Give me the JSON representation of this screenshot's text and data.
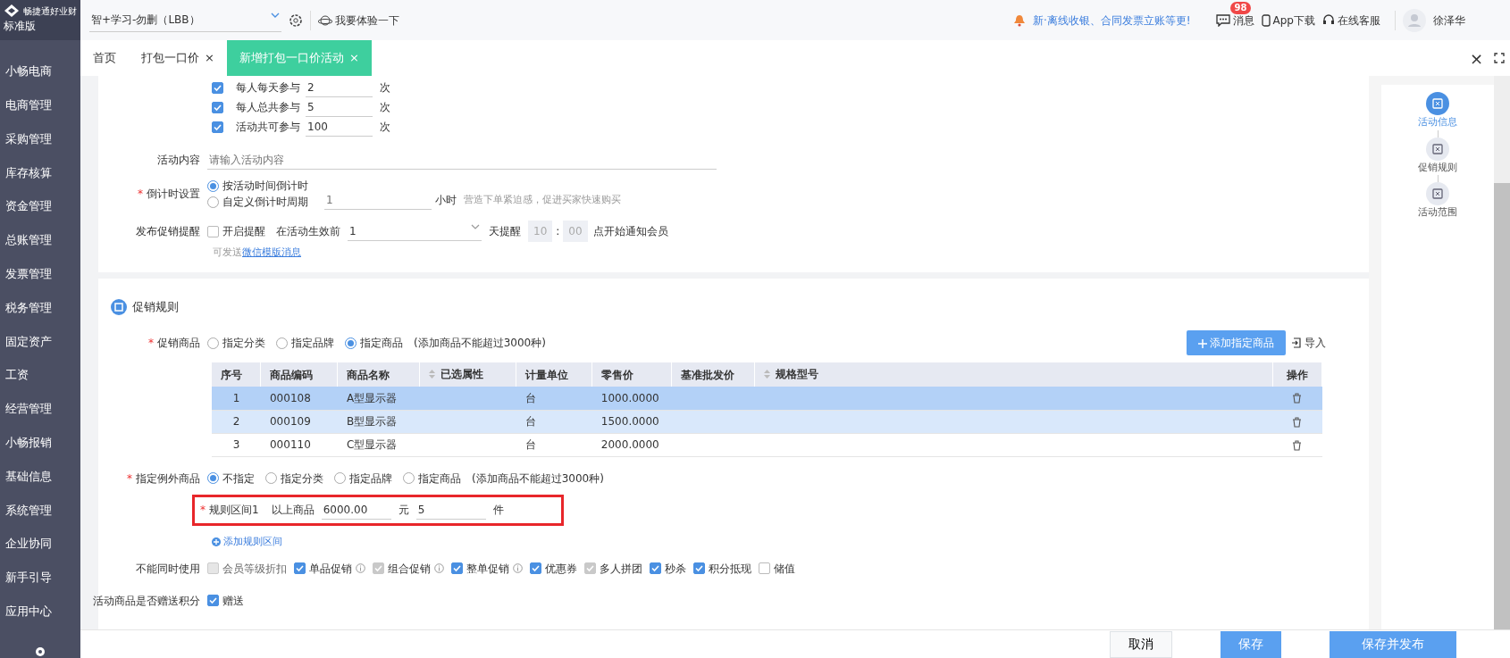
{
  "logo": {
    "brand": "畅捷通好业财",
    "edition": "标准版"
  },
  "sidebar": {
    "items": [
      {
        "label": "小畅电商"
      },
      {
        "label": "电商管理"
      },
      {
        "label": "采购管理"
      },
      {
        "label": "库存核算"
      },
      {
        "label": "资金管理"
      },
      {
        "label": "总账管理"
      },
      {
        "label": "发票管理"
      },
      {
        "label": "税务管理"
      },
      {
        "label": "固定资产"
      },
      {
        "label": "工资"
      },
      {
        "label": "经营管理"
      },
      {
        "label": "小畅报销"
      },
      {
        "label": "基础信息"
      },
      {
        "label": "系统管理"
      },
      {
        "label": "企业协同"
      },
      {
        "label": "新手引导"
      },
      {
        "label": "应用中心"
      }
    ]
  },
  "header": {
    "org": "智+学习-勿删（LBB）",
    "try_label": "我要体验一下",
    "notice": "新·离线收银、合同发票立账等更!",
    "messages": "消息",
    "message_count": "98",
    "app": "App下载",
    "service": "在线客服",
    "user": "徐泽华"
  },
  "tabs": [
    {
      "label": "首页",
      "selected": false
    },
    {
      "label": "打包一口价",
      "close": "×",
      "selected": false
    },
    {
      "label": "新增打包一口价活动",
      "close": "×",
      "selected": true
    }
  ],
  "window_close": "×",
  "limits": [
    {
      "checked": true,
      "label": "每人每天参与",
      "value": "2",
      "unit": "次"
    },
    {
      "checked": true,
      "label": "每人总共参与",
      "value": "5",
      "unit": "次"
    },
    {
      "checked": true,
      "label": "活动共可参与",
      "value": "100",
      "unit": "次"
    }
  ],
  "content_field": {
    "label": "活动内容",
    "placeholder": "请输入活动内容"
  },
  "countdown": {
    "label": "倒计时设置",
    "mark": "*",
    "options": [
      {
        "label": "按活动时间倒计时",
        "selected": true
      },
      {
        "label": "自定义倒计时周期",
        "selected": false
      }
    ],
    "placeholder": "1",
    "unit": "小时",
    "hint": "营造下单紧迫感，促进买家快速购买"
  },
  "reminder": {
    "label": "发布促销提醒",
    "checkbox": {
      "label": "开启提醒",
      "checked": false
    },
    "before": "在活动生效前",
    "days": "1",
    "days_unit": "天提醒",
    "hour": "10",
    "sep": ":",
    "minute": "00",
    "after": "点开始通知会员",
    "note": "可发送",
    "note_link": "微信模版消息"
  },
  "rules": {
    "title": "促销规则",
    "goods": {
      "label": "促销商品",
      "mark": "*",
      "options": [
        {
          "label": "指定分类",
          "selected": false
        },
        {
          "label": "指定品牌",
          "selected": false
        },
        {
          "label": "指定商品",
          "selected": true
        }
      ],
      "note": "(添加商品不能超过3000种)"
    },
    "add_button": "添加指定商品",
    "import_button": "导入",
    "table": {
      "columns": [
        {
          "label": "序号",
          "sortable": false
        },
        {
          "label": "商品编码",
          "sortable": false
        },
        {
          "label": "商品名称",
          "sortable": false
        },
        {
          "label": "已选属性",
          "sortable": true
        },
        {
          "label": "计量单位",
          "sortable": false
        },
        {
          "label": "零售价",
          "sortable": false
        },
        {
          "label": "基准批发价",
          "sortable": false
        },
        {
          "label": "规格型号",
          "sortable": true
        },
        {
          "label": "操作",
          "sortable": false
        }
      ],
      "rows": [
        {
          "cells": [
            "1",
            "000108",
            "A型显示器",
            "",
            "台",
            "1000.0000",
            "",
            "",
            ""
          ],
          "selected": true,
          "hovered": false
        },
        {
          "cells": [
            "2",
            "000109",
            "B型显示器",
            "",
            "台",
            "1500.0000",
            "",
            "",
            ""
          ],
          "selected": false,
          "hovered": true
        },
        {
          "cells": [
            "3",
            "000110",
            "C型显示器",
            "",
            "台",
            "2000.0000",
            "",
            "",
            ""
          ],
          "selected": false,
          "hovered": false
        }
      ]
    },
    "exclude": {
      "label": "指定例外商品",
      "mark": "*",
      "options": [
        {
          "label": "不指定",
          "selected": true
        },
        {
          "label": "指定分类",
          "selected": false
        },
        {
          "label": "指定品牌",
          "selected": false
        },
        {
          "label": "指定商品",
          "selected": false
        }
      ],
      "note": "(添加商品不能超过3000种)"
    },
    "interval": {
      "label": "规则区间1",
      "mark": "*",
      "prefix": "以上商品",
      "amount": "6000.00",
      "amount_unit": "元",
      "count": "5",
      "count_unit": "件"
    },
    "add_interval": "添加规则区间",
    "exclusive": {
      "label": "不能同时使用",
      "items": [
        {
          "label": "会员等级折扣",
          "checked": false,
          "disabled": true,
          "info": false
        },
        {
          "label": "单品促销",
          "checked": true,
          "disabled": false,
          "info": true
        },
        {
          "label": "组合促销",
          "checked": true,
          "disabled": true,
          "info": true
        },
        {
          "label": "整单促销",
          "checked": true,
          "disabled": false,
          "info": true
        },
        {
          "label": "优惠券",
          "checked": true,
          "disabled": false,
          "info": false
        },
        {
          "label": "多人拼团",
          "checked": true,
          "disabled": true,
          "info": false
        },
        {
          "label": "秒杀",
          "checked": true,
          "disabled": false,
          "info": false
        },
        {
          "label": "积分抵现",
          "checked": true,
          "disabled": false,
          "info": false
        },
        {
          "label": "储值",
          "checked": false,
          "disabled": false,
          "info": false
        }
      ]
    },
    "points": {
      "label": "活动商品是否赠送积分",
      "checkbox": {
        "label": "赠送",
        "checked": true
      }
    }
  },
  "steps": [
    {
      "label": "活动信息",
      "selected": true
    },
    {
      "label": "促销规则",
      "selected": false
    },
    {
      "label": "活动范围",
      "selected": false
    }
  ],
  "footer": {
    "cancel": "取消",
    "save": "保存",
    "publish": "保存并发布"
  }
}
